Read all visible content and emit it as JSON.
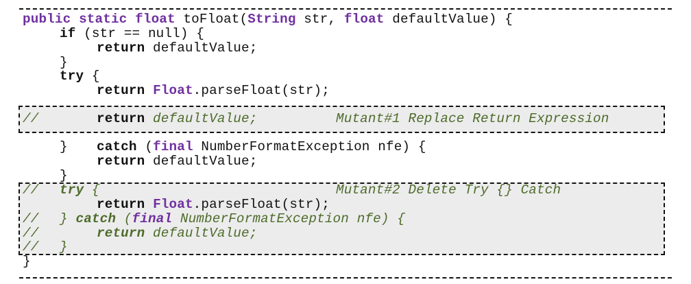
{
  "code": {
    "l1": {
      "public": "public",
      "static": "static",
      "float": "float",
      "sig_rest": " toFloat(",
      "String": "String",
      "sig_mid": " str, ",
      "float2": "float",
      "sig_end": " defaultValue) {"
    },
    "l2": {
      "if": "if",
      "rest": " (str == null) {"
    },
    "l3": {
      "return": "return",
      "rest": " defaultValue;"
    },
    "l4": {
      "brace": "}"
    },
    "l5": {
      "try": "try",
      "rest": " {"
    },
    "l6": {
      "return": "return",
      "Float": "Float",
      "rest": ".parseFloat(str);"
    },
    "l7": {
      "comment": "//",
      "return": "return",
      "rest": " defaultValue;",
      "mutant": "Mutant#1 Replace Return Expression"
    },
    "l8": {
      "brace": "}",
      "catch": "catch",
      "open": " (",
      "final": "final",
      "rest": " NumberFormatException nfe) {"
    },
    "l9": {
      "return": "return",
      "rest": " defaultValue;"
    },
    "l10": {
      "brace": "}"
    },
    "l11": {
      "comment": "//",
      "try": "try",
      "rest": " {",
      "mutant": "Mutant#2 Delete Try {} Catch"
    },
    "l12": {
      "return": "return",
      "Float": "Float",
      "rest": ".parseFloat(str);"
    },
    "l13": {
      "comment": "//",
      "brace": "}",
      "catch": "catch",
      "open": " (",
      "final": "final",
      "rest": " NumberFormatException nfe) {"
    },
    "l14": {
      "comment": "//",
      "return": "return",
      "rest": " defaultValue;"
    },
    "l15": {
      "comment": "//",
      "brace": "}"
    },
    "l16": {
      "brace": "}"
    }
  }
}
